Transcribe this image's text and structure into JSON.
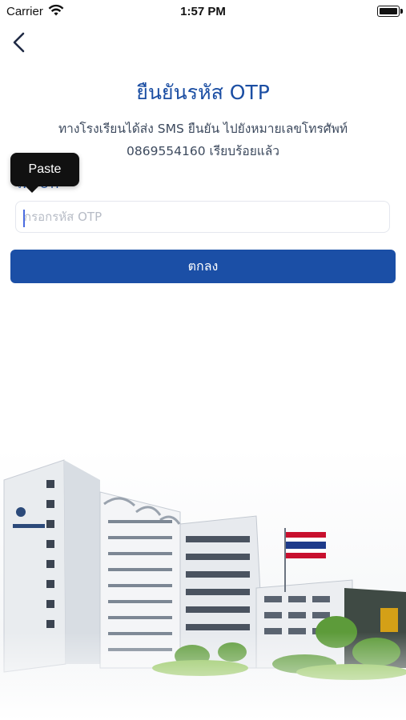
{
  "status_bar": {
    "carrier": "Carrier",
    "time": "1:57 PM"
  },
  "header": {
    "back_icon": "chevron-left-icon"
  },
  "content": {
    "title": "ยืนยันรหัส OTP",
    "message_line1": "ทางโรงเรียนได้ส่ง SMS ยืนยัน ไปยังหมายเลขโทรศัพท์",
    "message_line2": "0869554160 เรียบร้อยแล้ว",
    "field_label": "รหัส OTP",
    "otp_placeholder": "กรอกรหัส OTP",
    "otp_value": "",
    "submit_label": "ตกลง"
  },
  "tooltip": {
    "paste_label": "Paste"
  },
  "colors": {
    "primary": "#1b4fa6",
    "title": "#1b4ea3",
    "text": "#3d4a5e"
  }
}
